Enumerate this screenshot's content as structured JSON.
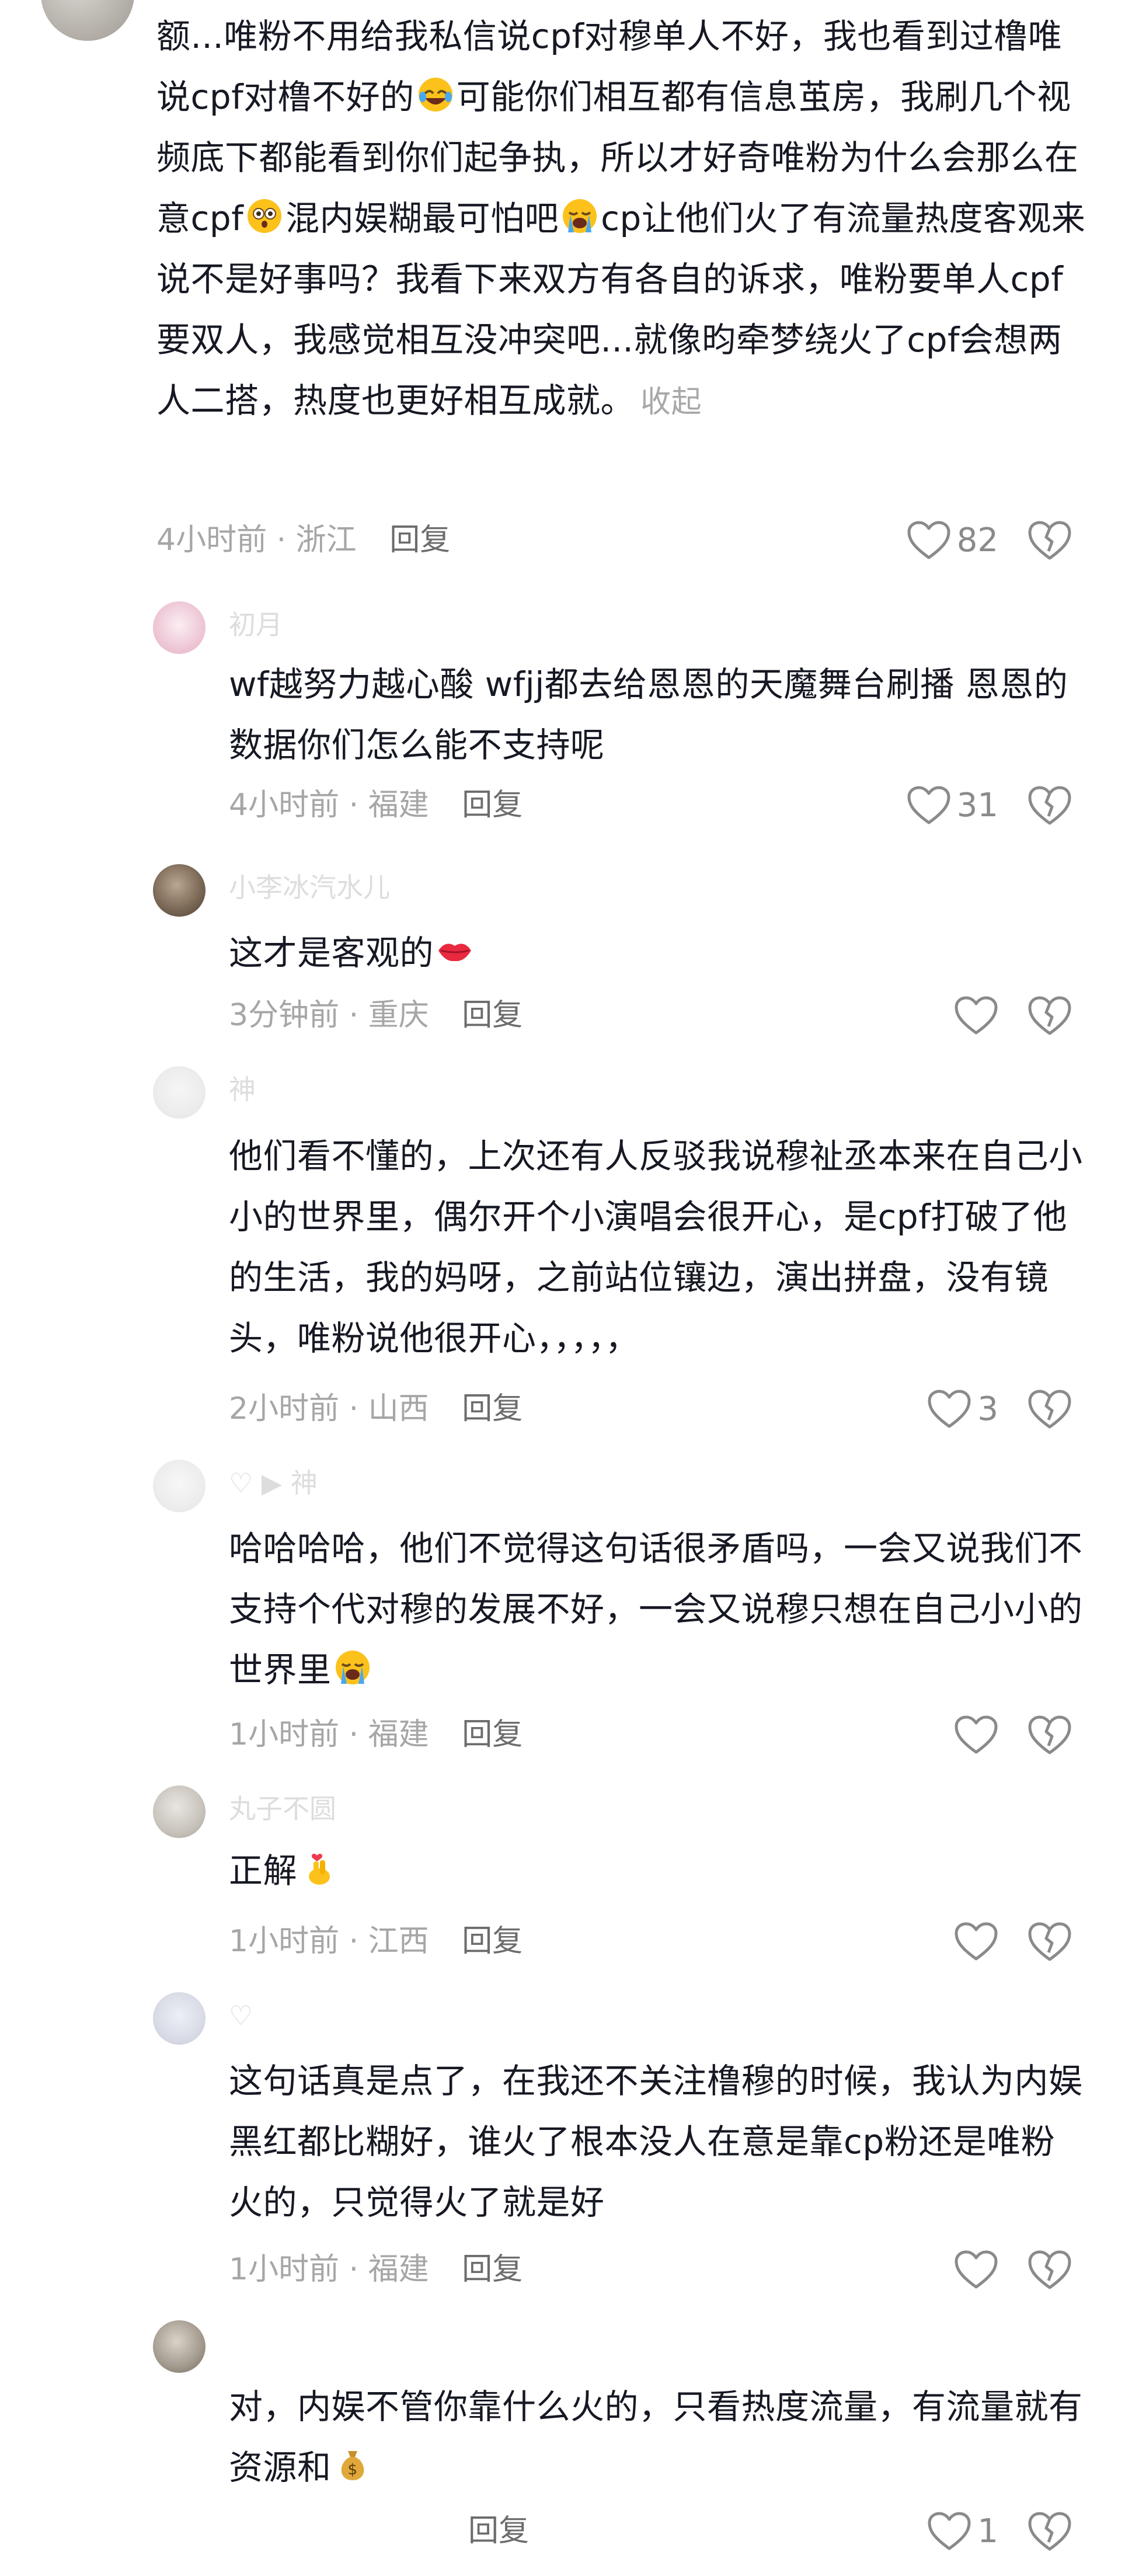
{
  "comments": [
    {
      "text": "额...唯粉不用给我私信说cpf对穆单人不好，我也看到过橹唯说cpf对橹不好的",
      "text2": "可能你们相互都有信息茧房，我刷几个视频底下都能看到你们起争执，所以才好奇唯粉为什么会那么在意cpf",
      "text3": "混内娱糊最可怕吧",
      "text4": "cp让他们火了有流量热度客观来说不是好事吗？我看下来双方有各自的诉求，唯粉要单人cpf要双人，我感觉相互没冲突吧...就像昀牵梦绕火了cpf会想两人二搭，热度也更好相互成就。",
      "collapse": "收起",
      "time": "4小时前 · 浙江",
      "reply": "回复",
      "likes": "82"
    }
  ],
  "replies": [
    {
      "username": "初月",
      "text": "wf越努力越心酸 wfjj都去给恩恩的天魔舞台刷播 恩恩的数据你们怎么能不支持呢",
      "time": "4小时前 · 福建",
      "reply": "回复",
      "likes": "31"
    },
    {
      "username": "小李冰汽水儿",
      "text": "这才是客观的",
      "time": "3分钟前 · 重庆",
      "reply": "回复",
      "likes": ""
    },
    {
      "username": "神",
      "text": "他们看不懂的，上次还有人反驳我说穆祉丞本来在自己小小的世界里，偶尔开个小演唱会很开心，是cpf打破了他的生活，我的妈呀，之前站位镶边，演出拼盘，没有镜头，唯粉说他很开心，，，，，",
      "time": "2小时前 · 山西",
      "reply": "回复",
      "likes": "3"
    },
    {
      "username": "♡ ▶ 神",
      "text": "哈哈哈哈，他们不觉得这句话很矛盾吗，一会又说我们不支持个代对穆的发展不好，一会又说穆只想在自己小小的世界里",
      "time": "1小时前 · 福建",
      "reply": "回复",
      "likes": ""
    },
    {
      "username": "丸子不圆",
      "text": "正解",
      "time": "1小时前 · 江西",
      "reply": "回复",
      "likes": ""
    },
    {
      "username": "♡",
      "text": "这句话真是点了，在我还不关注橹穆的时候，我认为内娱黑红都比糊好，谁火了根本没人在意是靠cp粉还是唯粉火的，只觉得火了就是好",
      "time": "1小时前 · 福建",
      "reply": "回复",
      "likes": ""
    },
    {
      "username": "",
      "text": "对，内娱不管你靠什么火的，只看热度流量，有流量就有资源和",
      "time": "",
      "reply": "回复",
      "likes": "1"
    }
  ],
  "icons": {
    "like": "heart-outline-icon",
    "dislike": "broken-heart-icon",
    "emoji_laugh_cry": "rolling-laughing-emoji",
    "emoji_shocked": "flushed-emoji",
    "emoji_crying": "loudly-crying-emoji",
    "emoji_lips": "kiss-lips-emoji",
    "emoji_finger_heart": "finger-heart-emoji",
    "emoji_money": "money-bag-emoji"
  },
  "colors": {
    "text": "#161823",
    "meta": "#a6a6a6",
    "reply": "#6c6c6c",
    "icon": "#8a8a8a"
  }
}
